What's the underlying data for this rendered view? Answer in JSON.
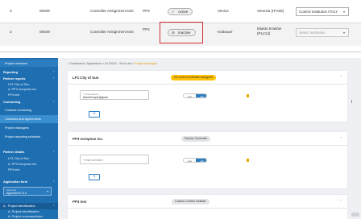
{
  "table": {
    "rows": [
      {
        "num": "3",
        "code": "00029",
        "type": "Controller Assignment test",
        "pp": "PP3",
        "status": "Active",
        "city": "Venice",
        "region": "Venezia (ITH35)",
        "select": "Control Institution ITALY"
      },
      {
        "num": "3",
        "code": "00029",
        "type": "Controller Assignment test",
        "pp": "PP4",
        "status": "Inactive",
        "city": "Krakauer",
        "region": "Miasto Kraków (PL213)",
        "select": "Select institution"
      }
    ]
  },
  "sidebar": {
    "items": [
      {
        "label": "Project overview"
      },
      {
        "label": "Reporting"
      },
      {
        "label": "Partner reports"
      },
      {
        "label": "LP1 City of Sun"
      },
      {
        "label": "A. PP3 european inc."
      },
      {
        "label": "PP4 test"
      },
      {
        "label": "Contracting"
      },
      {
        "label": "Contract monitoring"
      },
      {
        "label": "Contracts and agreements"
      },
      {
        "label": "Project managers"
      },
      {
        "label": "Project reporting schedule"
      },
      {
        "label": "Partner details"
      },
      {
        "label": "LP1 City of Sun"
      },
      {
        "label": "A. PP3 european inc."
      },
      {
        "label": "PP4 test"
      },
      {
        "label": "Application form"
      },
      {
        "label": "Approved"
      },
      {
        "label": "Approved in 'E.0"
      },
      {
        "label": "A - Project identification"
      },
      {
        "label": "A. Project identification"
      },
      {
        "label": "A. Project summary/index"
      }
    ]
  },
  "breadcrumb": {
    "parts": [
      "Dashboard",
      "Applications",
      "04 00031 - Sun is fun"
    ],
    "current": "Project privileges"
  },
  "cards": [
    {
      "title": "LP1 City of Sun",
      "pill": "No control institution assigned",
      "field_label": "* email address",
      "field_value": "tamethorpe@gswi",
      "view": "view",
      "edit": "edit",
      "add": "+"
    },
    {
      "title": "PP3 european inc.",
      "pill": "Partner Controller",
      "field_label": "* email username",
      "field_value": "",
      "view": "view",
      "edit": "edit",
      "add": "+"
    },
    {
      "title": "PP3 test",
      "pill": "Custom Control Institute"
    }
  ],
  "icons": {
    "active": "check-icon",
    "inactive": "person-off-icon",
    "chevron": "chevron-icon",
    "delete": "trash-icon",
    "cursor": "text-cursor-icon"
  }
}
